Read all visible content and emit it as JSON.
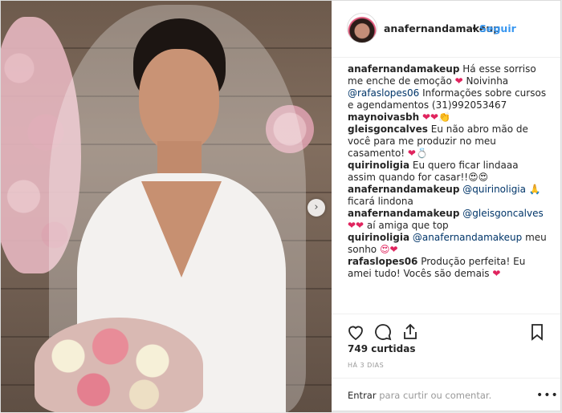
{
  "post": {
    "username": "anafernandamakeup",
    "dot": "•",
    "follow_label": "Seguir",
    "next_label": "›"
  },
  "comments": [
    {
      "user": "anafernandamakeup",
      "parts": [
        {
          "t": "Há esse sorriso me enche de emoção "
        },
        {
          "t": "❤",
          "cls": "h"
        },
        {
          "t": " Noivinha "
        },
        {
          "t": "@rafaslopes06",
          "cls": "m"
        },
        {
          "t": " Informações sobre cursos e agendamentos (31)992053467"
        }
      ]
    },
    {
      "user": "maynoivasbh",
      "parts": [
        {
          "t": "❤❤",
          "cls": "h"
        },
        {
          "t": "👏"
        }
      ]
    },
    {
      "user": "gleisgoncalves",
      "parts": [
        {
          "t": "Eu não abro mão de você para me produzir no meu casamento! "
        },
        {
          "t": "❤",
          "cls": "h"
        },
        {
          "t": "💍"
        }
      ]
    },
    {
      "user": "quirinoligia",
      "parts": [
        {
          "t": "Eu quero ficar lindaaa assim quando for casar!!"
        },
        {
          "t": "😍😍"
        }
      ]
    },
    {
      "user": "anafernandamakeup",
      "parts": [
        {
          "t": "@quirinoligia",
          "cls": "m"
        },
        {
          "t": " 🙏 ficará lindona"
        }
      ]
    },
    {
      "user": "anafernandamakeup",
      "parts": [
        {
          "t": "@gleisgoncalves",
          "cls": "m"
        },
        {
          "t": " "
        },
        {
          "t": "❤❤",
          "cls": "h"
        },
        {
          "t": " aí amiga que top"
        }
      ]
    },
    {
      "user": "quirinoligia",
      "parts": [
        {
          "t": "@anafernandamakeup",
          "cls": "m"
        },
        {
          "t": " meu sonho "
        },
        {
          "t": "😍❤",
          "cls": "h"
        }
      ]
    },
    {
      "user": "rafaslopes06",
      "parts": [
        {
          "t": "Produção perfeita! Eu amei tudo! Vocês são demais "
        },
        {
          "t": "❤",
          "cls": "h"
        }
      ]
    }
  ],
  "actions": {
    "likes": "749 curtidas",
    "time": "HÁ 3 DIAS"
  },
  "composer": {
    "login_link": "Entrar",
    "placeholder": " para curtir ou comentar.",
    "more": "•••"
  },
  "colors": {
    "link_blue": "#3897f0",
    "mention": "#003569",
    "heart_red": "#e0245e"
  }
}
